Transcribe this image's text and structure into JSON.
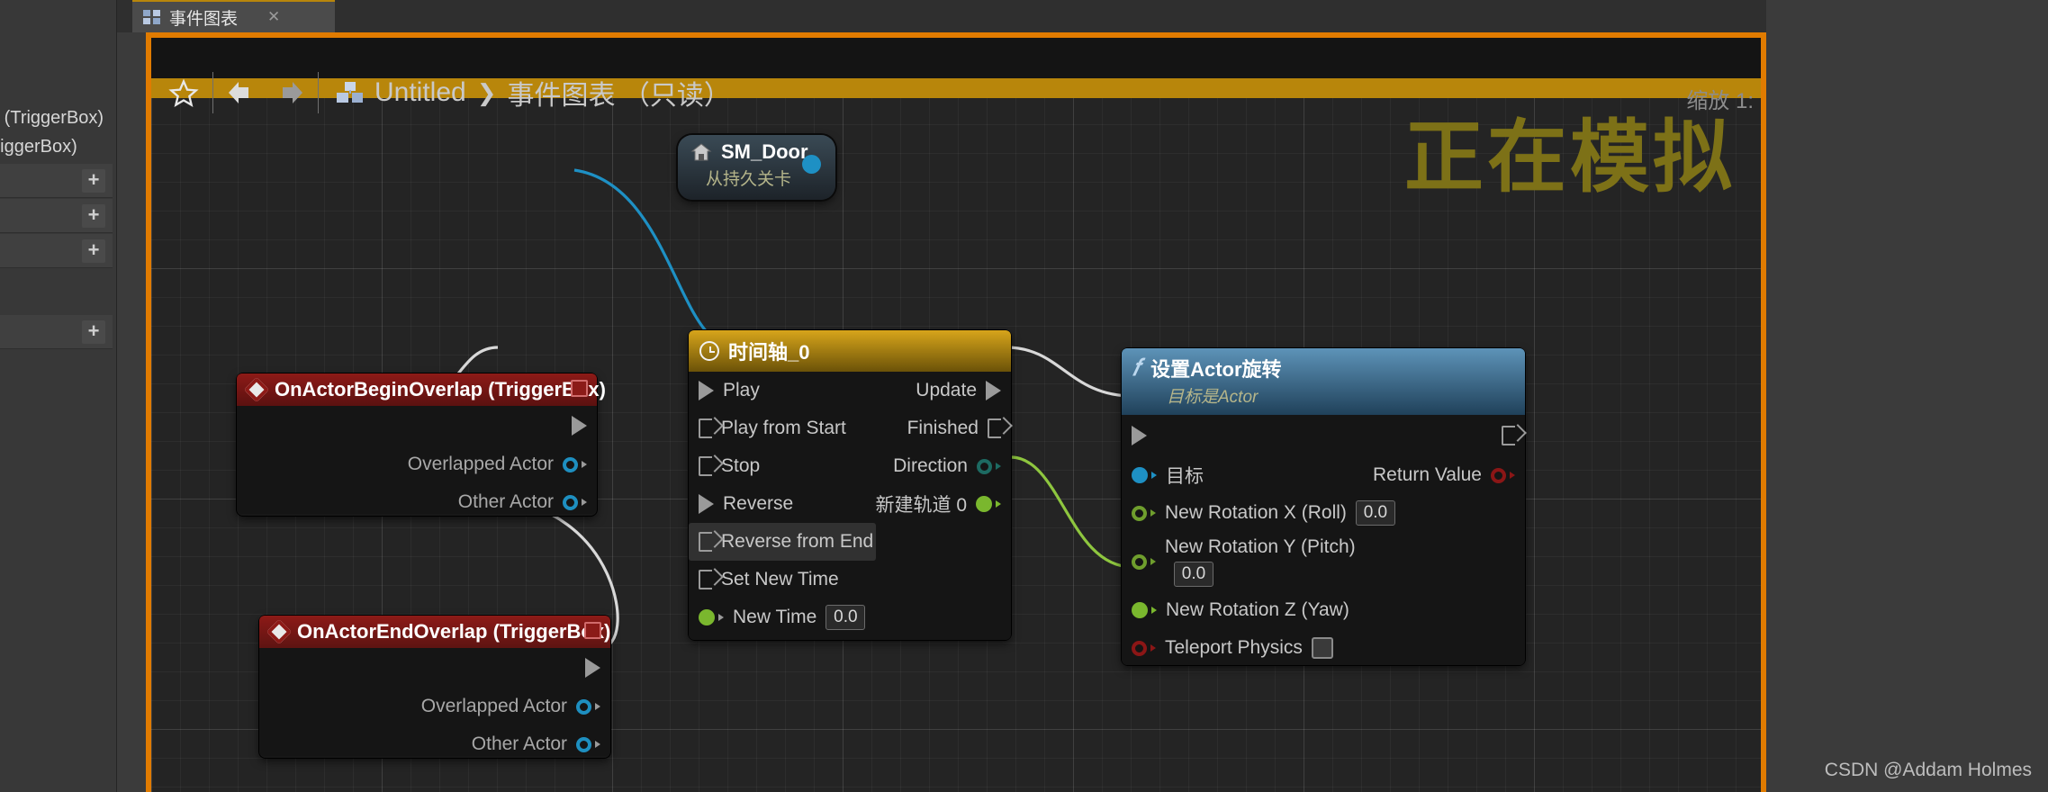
{
  "window": {
    "tab": {
      "label": "事件图表",
      "close": "✕",
      "icon": "blueprint-grid-icon"
    }
  },
  "left_panel": {
    "truncated_labels": [
      "p (TriggerBox)",
      "TriggerBox)"
    ],
    "add_button_label": "+"
  },
  "toolbar": {
    "favorite_icon": "star-icon",
    "back_icon": "arrow-left-icon",
    "forward_icon": "arrow-right-icon",
    "graph_icon": "blueprint-grid-icon",
    "breadcrumb": {
      "root": "Untitled",
      "separator": "❯",
      "current": "事件图表 （只读）"
    }
  },
  "overlays": {
    "simulating": "正在模拟",
    "zoom_label": "缩放 1:",
    "watermark": "CSDN @Addam Holmes"
  },
  "nodes": {
    "actor_ref": {
      "title": "SM_Door",
      "subtitle": "从持久关卡",
      "icon": "house-icon",
      "output_pin": "object-pin"
    },
    "begin_overlap": {
      "title": "OnActorBeginOverlap (TriggerBox)",
      "icon": "event-diamond-icon",
      "badge": "delegate-square-icon",
      "outputs": [
        "Overlapped Actor",
        "Other Actor"
      ]
    },
    "end_overlap": {
      "title": "OnActorEndOverlap (TriggerBox)",
      "icon": "event-diamond-icon",
      "badge": "delegate-square-icon",
      "outputs": [
        "Overlapped Actor",
        "Other Actor"
      ]
    },
    "timeline": {
      "title": "时间轴_0",
      "icon": "clock-icon",
      "inputs": [
        {
          "label": "Play",
          "type": "exec",
          "connected": true
        },
        {
          "label": "Play from Start",
          "type": "exec",
          "connected": false
        },
        {
          "label": "Stop",
          "type": "exec",
          "connected": false
        },
        {
          "label": "Reverse",
          "type": "exec",
          "connected": true
        },
        {
          "label": "Reverse from End",
          "type": "exec",
          "connected": false,
          "hovered": true
        },
        {
          "label": "Set New Time",
          "type": "exec",
          "connected": false
        },
        {
          "label": "New Time",
          "type": "float",
          "value": "0.0"
        }
      ],
      "outputs": [
        {
          "label": "Update",
          "type": "exec",
          "connected": true
        },
        {
          "label": "Finished",
          "type": "exec",
          "connected": false
        },
        {
          "label": "Direction",
          "type": "enum",
          "connected": false
        },
        {
          "label": "新建轨道 0",
          "type": "float",
          "connected": true
        }
      ]
    },
    "set_actor_rotation": {
      "title": "设置Actor旋转",
      "subtitle": "目标是Actor",
      "icon": "function-fx-icon",
      "inputs": [
        {
          "label": "",
          "type": "exec",
          "connected": true
        },
        {
          "label": "目标",
          "type": "object",
          "connected": true
        },
        {
          "label": "New Rotation X (Roll)",
          "type": "float",
          "value": "0.0"
        },
        {
          "label": "New Rotation Y (Pitch)",
          "type": "float",
          "value": "0.0"
        },
        {
          "label": "New Rotation Z (Yaw)",
          "type": "float",
          "connected": true
        },
        {
          "label": "Teleport Physics",
          "type": "bool",
          "value": false
        }
      ],
      "outputs": [
        {
          "label": "",
          "type": "exec",
          "connected": false
        },
        {
          "label": "Return Value",
          "type": "bool",
          "connected": false
        }
      ]
    }
  },
  "colors": {
    "accent_orange": "#e07b00",
    "gold": "#b8860b",
    "event_red": "#8d1a17",
    "function_blue": "#5d93b8",
    "exec_wire": "#d8d8d8",
    "object_wire": "#1e90c4",
    "float_wire": "#7ab72e"
  }
}
